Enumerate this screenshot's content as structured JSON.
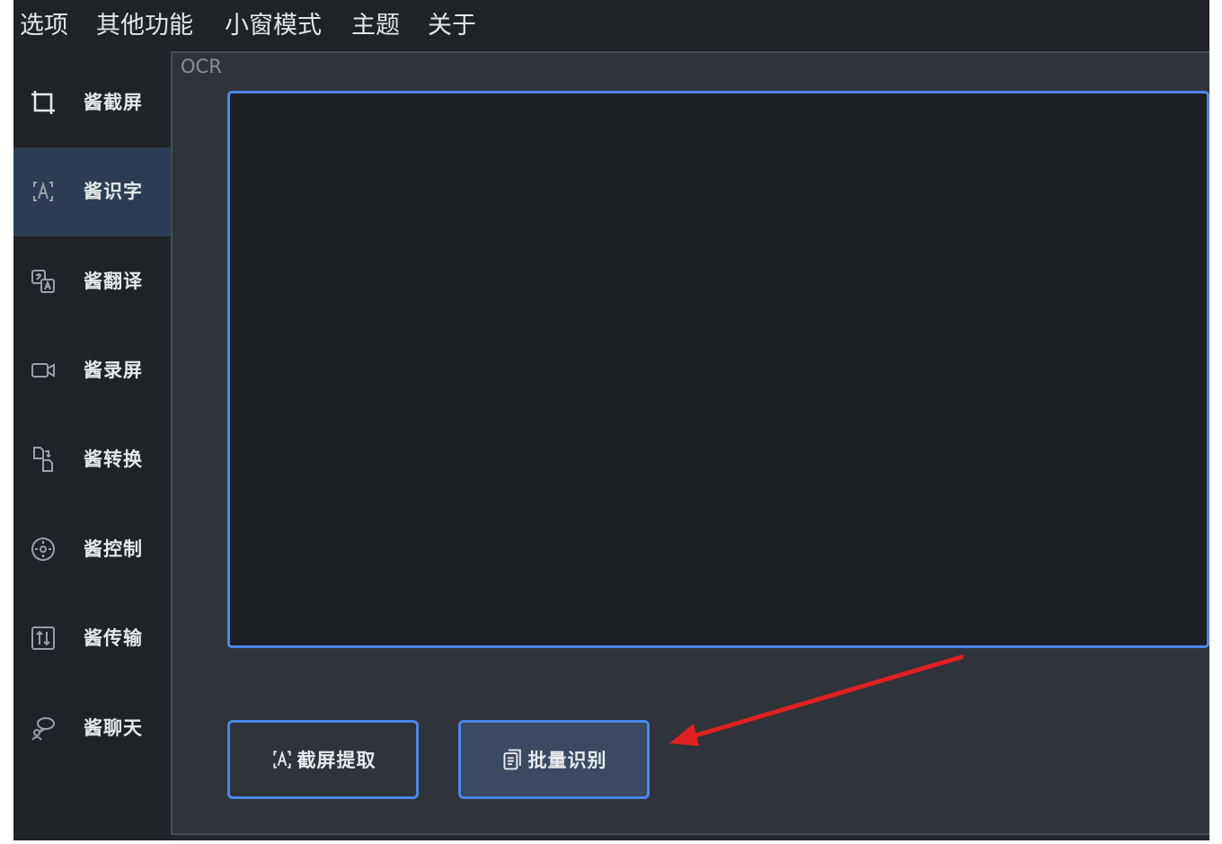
{
  "menubar": {
    "items": [
      {
        "label": "选项"
      },
      {
        "label": "其他功能"
      },
      {
        "label": "小窗模式"
      },
      {
        "label": "主题"
      },
      {
        "label": "关于"
      }
    ]
  },
  "sidebar": {
    "items": [
      {
        "label": "酱截屏",
        "icon": "crop-icon",
        "active": false
      },
      {
        "label": "酱识字",
        "icon": "text-recognition-icon",
        "active": true
      },
      {
        "label": "酱翻译",
        "icon": "translate-icon",
        "active": false
      },
      {
        "label": "酱录屏",
        "icon": "video-camera-icon",
        "active": false
      },
      {
        "label": "酱转换",
        "icon": "file-convert-icon",
        "active": false
      },
      {
        "label": "酱控制",
        "icon": "gamepad-icon",
        "active": false
      },
      {
        "label": "酱传输",
        "icon": "transfer-icon",
        "active": false
      },
      {
        "label": "酱聊天",
        "icon": "chat-icon",
        "active": false
      }
    ]
  },
  "panel": {
    "title": "OCR",
    "textarea_value": "",
    "buttons": {
      "screenshot_extract": {
        "label": "截屏提取",
        "icon": "text-recognition-icon"
      },
      "batch_recognize": {
        "label": "批量识别",
        "icon": "batch-document-icon"
      }
    }
  },
  "colors": {
    "background": "#24272c",
    "sidebar": "#1f2226",
    "active_item": "#2b3d55",
    "panel": "#2f333a",
    "accent": "#4a86e8",
    "annotation_arrow": "#e02020"
  }
}
